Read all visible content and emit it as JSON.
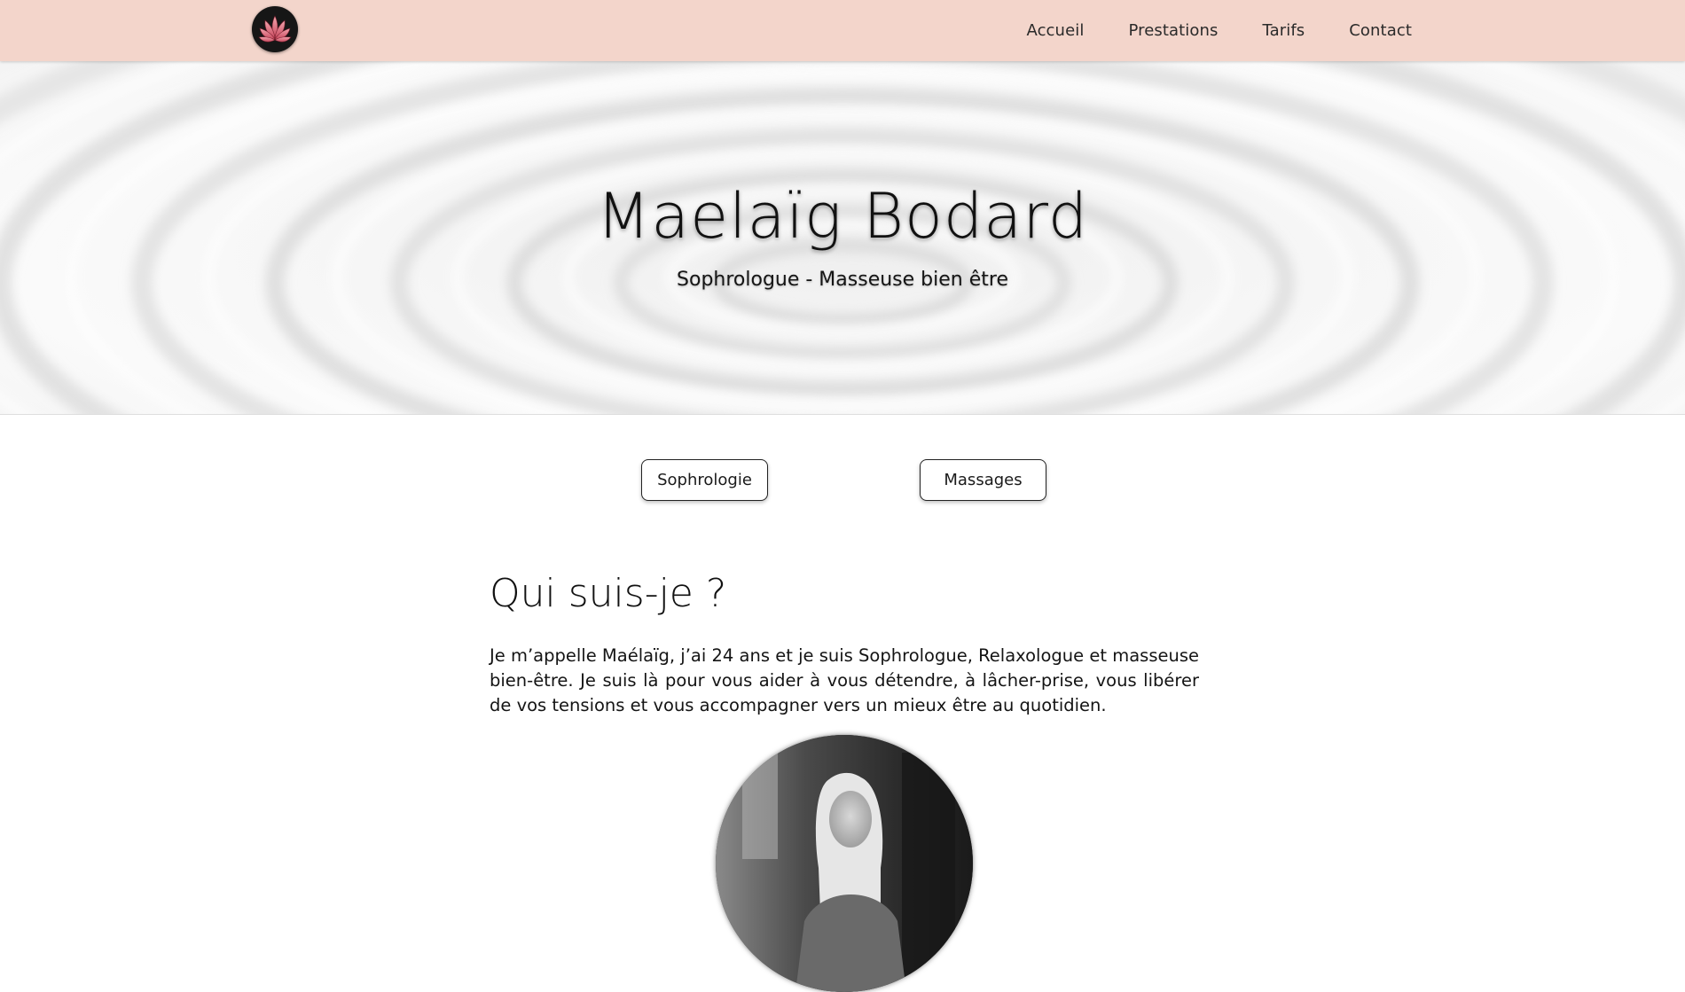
{
  "header": {
    "logo_icon": "lotus-logo-icon",
    "nav": {
      "home": "Accueil",
      "services": "Prestations",
      "prices": "Tarifs",
      "contact": "Contact"
    },
    "background_color": "#f3d5cb"
  },
  "hero": {
    "title": "Maelaïg Bodard",
    "subtitle": "Sophrologue - Masseuse bien être",
    "background": "zen-sand-ripples-image"
  },
  "services": {
    "sophrologie_label": "Sophrologie",
    "massages_label": "Massages"
  },
  "about": {
    "heading": "Qui suis-je ?",
    "text": "Je m’appelle Maélaïg, j’ai 24 ans et je suis Sophrologue, Relaxologue et masseuse bien-être. Je suis là pour vous aider à vous détendre, à lâcher-prise, vous libérer de vos tensions et vous accompagner vers un mieux être au quotidien.",
    "portrait": "portrait-photo"
  },
  "colors": {
    "accent_pink": "#f3d5cb",
    "logo_petals": "#e07a8a"
  }
}
